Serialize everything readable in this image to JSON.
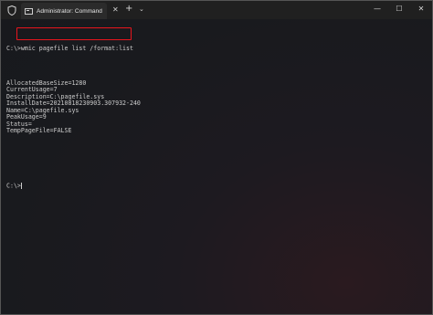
{
  "titlebar": {
    "shield_icon": "shield-icon",
    "tab_icon": "terminal-icon",
    "tab_title": "Administrator: Command Prom",
    "close_tab_glyph": "✕",
    "new_tab_glyph": "+",
    "dropdown_glyph": "⌄",
    "minimize_glyph": "—",
    "maximize_glyph": "☐",
    "close_glyph": "✕"
  },
  "terminal": {
    "command_line": "C:\\>wmic pagefile list /format:list",
    "output": [
      "",
      "",
      "AllocatedBaseSize=1280",
      "CurrentUsage=7",
      "Description=C:\\pagefile.sys",
      "InstallDate=20210818230903.307932-240",
      "Name=C:\\pagefile.sys",
      "PeakUsage=9",
      "Status=",
      "TempPageFile=FALSE",
      "",
      "",
      "",
      "",
      ""
    ],
    "prompt": "C:\\>",
    "highlight_color": "#e8151d"
  }
}
